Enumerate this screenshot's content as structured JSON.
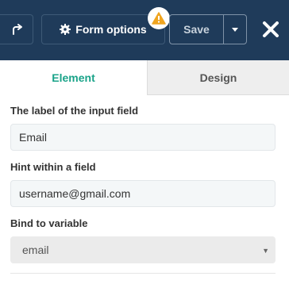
{
  "toolbar": {
    "redo_icon": "redo-icon",
    "form_options_icon": "gear-icon",
    "form_options_label": "Form options",
    "warning_icon": "warning-icon",
    "save_label": "Save",
    "save_menu_icon": "caret-down-icon",
    "close_icon": "close-icon",
    "colors": {
      "background": "#1f3b5a",
      "warning": "#f0a520"
    }
  },
  "tabs": [
    {
      "label": "Element",
      "active": true
    },
    {
      "label": "Design",
      "active": false
    }
  ],
  "form": {
    "label_field": {
      "label": "The label of the input field",
      "value": "Email"
    },
    "hint_field": {
      "label": "Hint within a field",
      "value": "username@gmail.com"
    },
    "bind_field": {
      "label": "Bind to variable",
      "selected": "email"
    }
  },
  "accent_color": "#1aa389"
}
